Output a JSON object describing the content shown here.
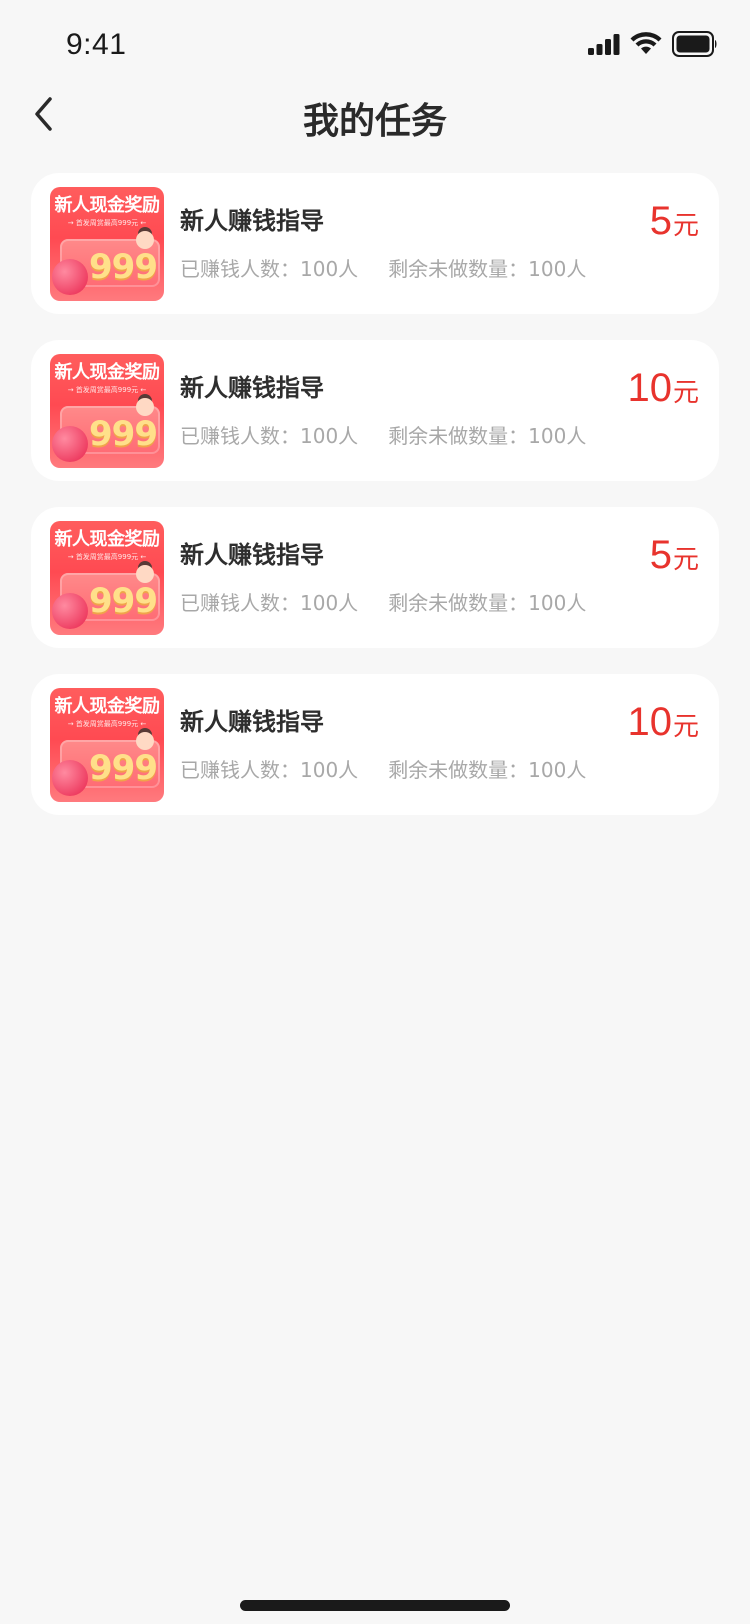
{
  "status_bar": {
    "time": "9:41",
    "signal_icon": "cellular-signal-icon",
    "wifi_icon": "wifi-icon",
    "battery_icon": "battery-icon"
  },
  "nav": {
    "back_icon": "chevron-left-icon",
    "title": "我的任务"
  },
  "colors": {
    "background": "#f7f7f7",
    "card": "#ffffff",
    "accent_red": "#e8332d",
    "meta_gray": "#a8a8a8"
  },
  "tasks": [
    {
      "thumb_title": "新人现金奖励",
      "thumb_sub": "→ 首发周赏最高999元 ←",
      "thumb_big": "999",
      "name": "新人赚钱指导",
      "earned_count": "已赚钱人数：100人",
      "remaining": "剩余未做数量：100人",
      "reward": "5",
      "reward_unit": "元"
    },
    {
      "thumb_title": "新人现金奖励",
      "thumb_sub": "→ 首发周赏最高999元 ←",
      "thumb_big": "999",
      "name": "新人赚钱指导",
      "earned_count": "已赚钱人数：100人",
      "remaining": "剩余未做数量：100人",
      "reward": "10",
      "reward_unit": "元"
    },
    {
      "thumb_title": "新人现金奖励",
      "thumb_sub": "→ 首发周赏最高999元 ←",
      "thumb_big": "999",
      "name": "新人赚钱指导",
      "earned_count": "已赚钱人数：100人",
      "remaining": "剩余未做数量：100人",
      "reward": "5",
      "reward_unit": "元"
    },
    {
      "thumb_title": "新人现金奖励",
      "thumb_sub": "→ 首发周赏最高999元 ←",
      "thumb_big": "999",
      "name": "新人赚钱指导",
      "earned_count": "已赚钱人数：100人",
      "remaining": "剩余未做数量：100人",
      "reward": "10",
      "reward_unit": "元"
    }
  ]
}
